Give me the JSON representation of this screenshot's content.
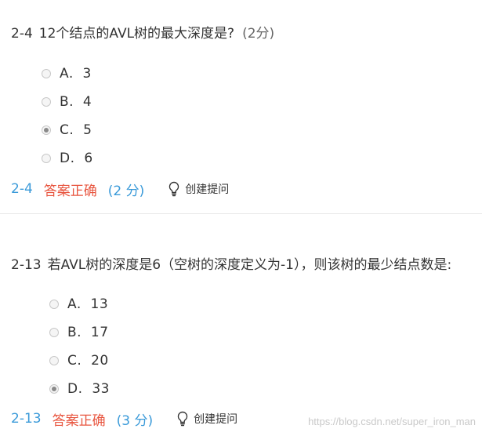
{
  "questions": [
    {
      "number": "2-4",
      "text": "12个结点的AVL树的最大深度是?",
      "score": "(2分)",
      "options": [
        {
          "letter": "A.",
          "value": "3",
          "selected": false
        },
        {
          "letter": "B.",
          "value": "4",
          "selected": false
        },
        {
          "letter": "C.",
          "value": "5",
          "selected": true
        },
        {
          "letter": "D.",
          "value": "6",
          "selected": false
        }
      ],
      "result": {
        "number": "2-4",
        "status": "答案正确",
        "score": "(2 分)",
        "hint_label": "创建提问"
      }
    },
    {
      "number": "2-13",
      "text": "若AVL树的深度是6（空树的深度定义为-1），则该树的最少结点数是:",
      "score": "",
      "options": [
        {
          "letter": "A.",
          "value": "13",
          "selected": false
        },
        {
          "letter": "B.",
          "value": "17",
          "selected": false
        },
        {
          "letter": "C.",
          "value": "20",
          "selected": false
        },
        {
          "letter": "D.",
          "value": "33",
          "selected": true
        }
      ],
      "result": {
        "number": "2-13",
        "status": "答案正确",
        "score": "(3 分)",
        "hint_label": "创建提问"
      }
    }
  ],
  "watermark": "https://blog.csdn.net/super_iron_man",
  "colors": {
    "accent_blue": "#3a9ad9",
    "correct_red": "#e8553f",
    "text": "#333333",
    "divider": "#e9e9e9"
  },
  "icons": {
    "hint": "lightbulb-icon",
    "radio": "radio-icon"
  }
}
